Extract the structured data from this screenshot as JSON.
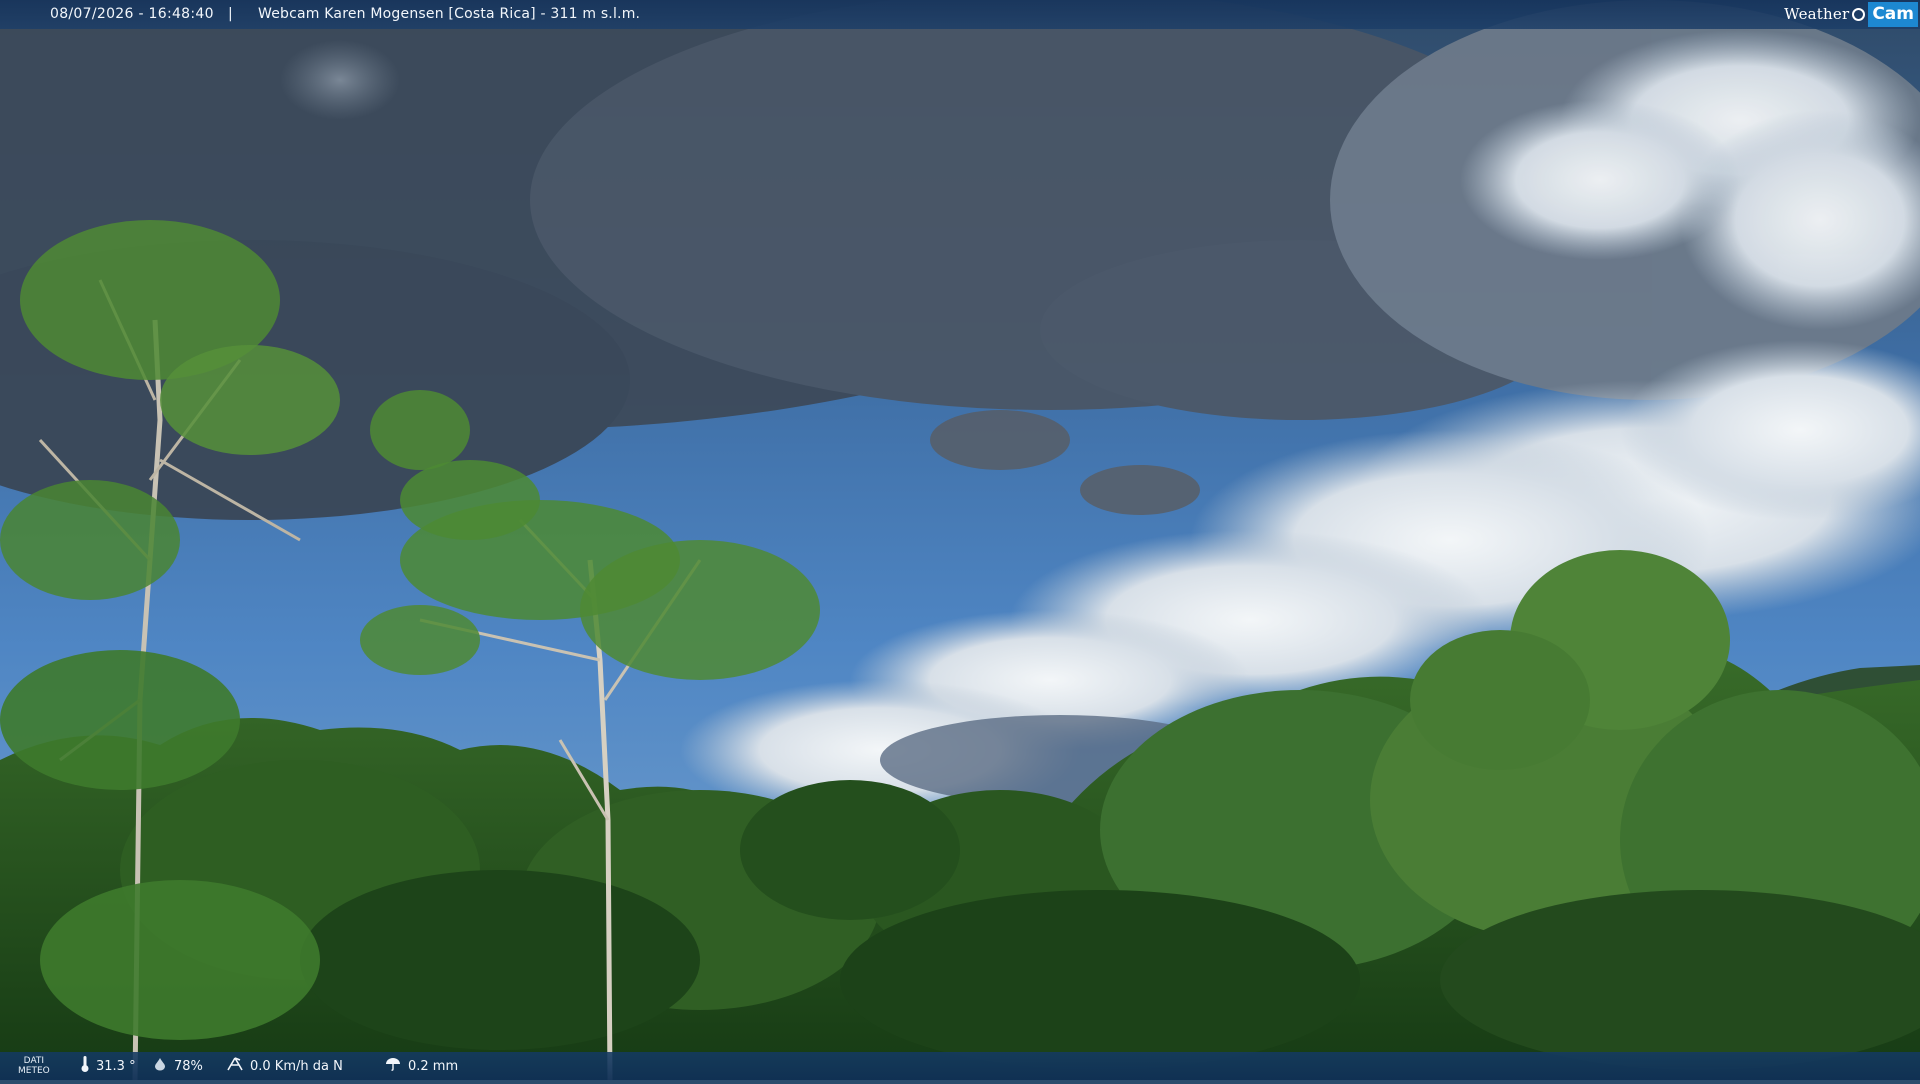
{
  "header": {
    "datetime": "08/07/2026 - 16:48:40",
    "separator": "|",
    "title": "Webcam Karen Mogensen [Costa Rica] - 311 m s.l.m."
  },
  "logo": {
    "weather": "Weather",
    "cam": "Cam"
  },
  "footer": {
    "dati_line1": "DATI",
    "dati_line2": "METEO",
    "temperature": "31.3 °",
    "humidity": "78%",
    "wind": "0.0 Km/h da N",
    "rain": "0.2 mm"
  },
  "icons": {
    "temperature": "thermometer-icon",
    "humidity": "humidity-icon",
    "wind": "wind-icon",
    "rain": "rain-icon"
  },
  "colors": {
    "sky_blue": "#4f86c4",
    "cloud_gray": "#5e6e82",
    "cloud_white": "#e8eef3",
    "foliage_dark": "#1f4a1c",
    "foliage_light": "#5f8f35",
    "bar_blue": "#1b3f6b",
    "logo_blue": "#1d88d1"
  }
}
